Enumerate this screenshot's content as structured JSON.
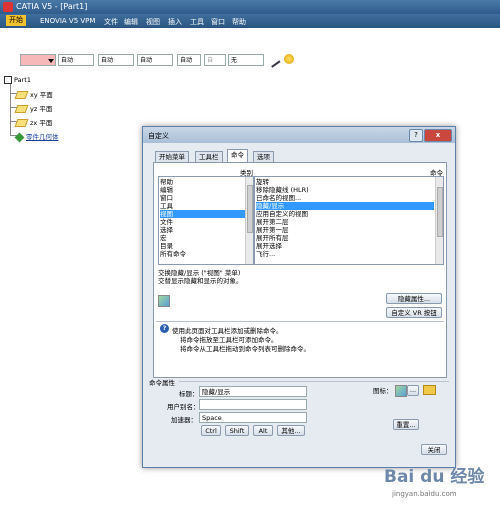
{
  "window": {
    "title": "CATIA V5 - [Part1]"
  },
  "menubar": {
    "items": [
      "开始",
      "ENOVIA V5 VPM",
      "文件",
      "编辑",
      "视图",
      "插入",
      "工具",
      "窗口",
      "帮助"
    ]
  },
  "toolbar": {
    "combos": [
      "自动",
      "自动",
      "自动",
      "自动",
      "自",
      "",
      "无"
    ]
  },
  "tree": {
    "root": "Part1",
    "children": [
      "xy 平面",
      "yz 平面",
      "zx 平面",
      "零件几何体"
    ]
  },
  "dialog": {
    "title": "自定义",
    "help_label": "?",
    "close_x": "x",
    "tabs": [
      "开始菜单",
      "工具栏",
      "命令",
      "选项"
    ],
    "active_tab": "命令",
    "categories_header": "类别",
    "commands_header": "命令",
    "categories": [
      "帮助",
      "编辑",
      "窗口",
      "工具",
      "视图",
      "文件",
      "选择",
      "宏",
      "目录",
      "所有命令"
    ],
    "selected_category": "视图",
    "commands": [
      "旋转",
      "移除隐藏线 (HLR)",
      "已命名的视图...",
      "隐藏/显示",
      "应用自定义的视图",
      "展开第二层",
      "展开第一层",
      "展开所有层",
      "展开选择",
      "飞行..."
    ],
    "selected_command": "隐藏/显示",
    "description_line1": "交换隐藏/显示 (\"视图\" 菜单)",
    "description_line2": "交替显示隐藏和显示的对象。",
    "show_properties_button": "隐藏属性...",
    "customize_vr_button": "自定义 VR 按钮",
    "tip_lines": [
      "使用此页面对工具栏添加或删除命令。",
      "将命令拖放至工具栏可添加命令。",
      "将命令从工具栏拖动到命令列表可删除命令。"
    ],
    "props_section": "命令属性",
    "title_label": "标题：",
    "title_value": "隐藏/显示",
    "user_alias_label": "用户别名：",
    "user_alias_value": "",
    "accelerator_label": "加速器：",
    "accelerator_value": "Space",
    "modifier_buttons": [
      "Ctrl",
      "Shift",
      "Alt",
      "其他..."
    ],
    "icon_label": "图标：",
    "icon_more": "...",
    "reset_button": "重置...",
    "close_button": "关闭"
  },
  "watermark": {
    "brand": "Bai du 经验",
    "url": "jingyan.baidu.com"
  }
}
